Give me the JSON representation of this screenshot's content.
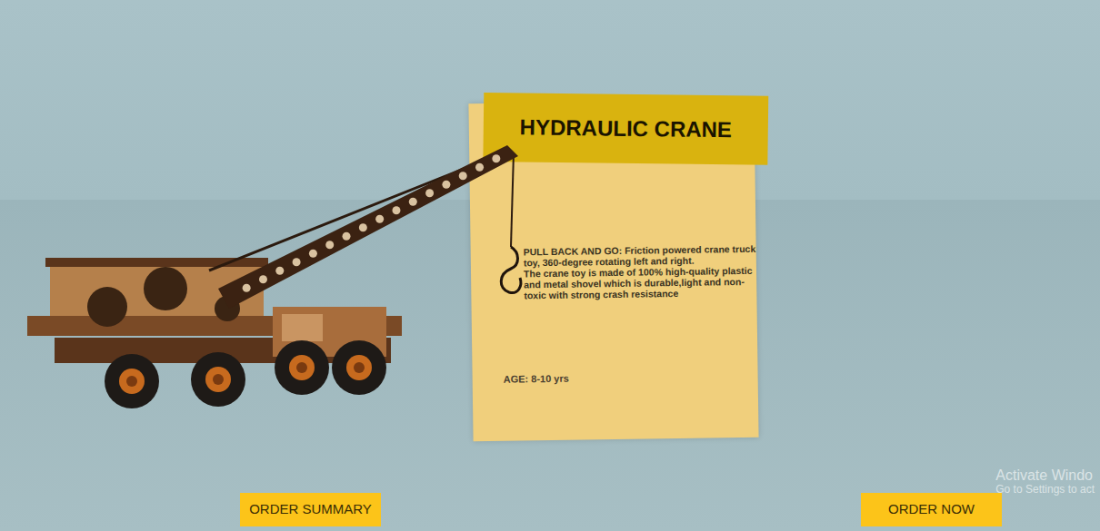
{
  "card": {
    "title": "HYDRAULIC CRANE",
    "description": [
      "PULL BACK AND GO: Friction powered crane truck toy, 360-degree rotating left and right.",
      "The crane toy is made of 100% high-quality plastic and metal shovel which is durable,light and non-toxic with strong crash resistance"
    ],
    "age": "AGE: 8-10 yrs"
  },
  "buttons": [
    {
      "label": "ORDER SUMMARY"
    },
    {
      "label": "ORDER NOW"
    }
  ],
  "watermark": {
    "title": "Activate Windo",
    "subtitle": "Go to Settings to act"
  }
}
